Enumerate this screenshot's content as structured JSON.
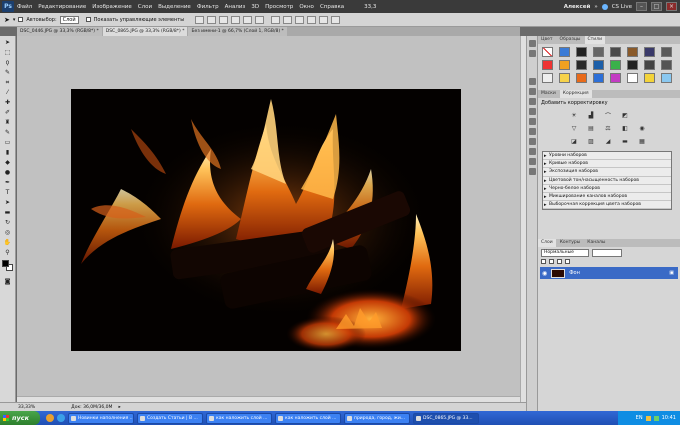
{
  "menubar": {
    "logo": "Ps",
    "items": [
      "Файл",
      "Редактирование",
      "Изображение",
      "Слои",
      "Выделение",
      "Фильтр",
      "Анализ",
      "3D",
      "Просмотр",
      "Окно",
      "Справка"
    ],
    "zoom": "33,3",
    "user": "Алексей",
    "cslive": "CS Live"
  },
  "options": {
    "autoselect_label": "Автовыбор:",
    "autoselect_value": "Слой",
    "transform_label": "Показать управляющие элементы"
  },
  "tabs": [
    {
      "label": "DSC_0446.JPG @ 33,3% (RGB/8*) *"
    },
    {
      "label": "DSC_0865.JPG @ 33,3% (RGB/8*) *"
    },
    {
      "label": "Без имени-1 @ 66,7% (Слой 1, RGB/8) *"
    }
  ],
  "status": {
    "zoom": "33,33%",
    "doc": "Док: 36,0М/36,0М"
  },
  "panel_tabs": [
    "Цвет",
    "Образцы",
    "Стили"
  ],
  "adjust_tabs": [
    "Маски",
    "Коррекция"
  ],
  "adjust_title": "Добавить корректировку",
  "presets": [
    "Уровни наборов",
    "Кривые наборов",
    "Экспозиция наборов",
    "Цветовой тон/насыщенность наборов",
    "Черно-белое наборов",
    "Микширование каналов наборов",
    "Выборочная коррекция цвета наборов"
  ],
  "layers_tabs": [
    "Слои",
    "Контуры",
    "Каналы"
  ],
  "blend_mode": "Нормальные",
  "layer": {
    "name": "Фон"
  },
  "taskbar": {
    "start": "пуск",
    "tasks": [
      "Новинки наполнения ...",
      "Создать Статьи | В ...",
      "как наложить слой ...",
      "как наложить слой ...",
      "природа, город, жи...",
      "DSC_0865.JPG @ 33..."
    ],
    "lang": "EN",
    "time": "10:41"
  },
  "colors": {
    "accent": "#3a6ac6",
    "taskbar": "#2457c5"
  }
}
